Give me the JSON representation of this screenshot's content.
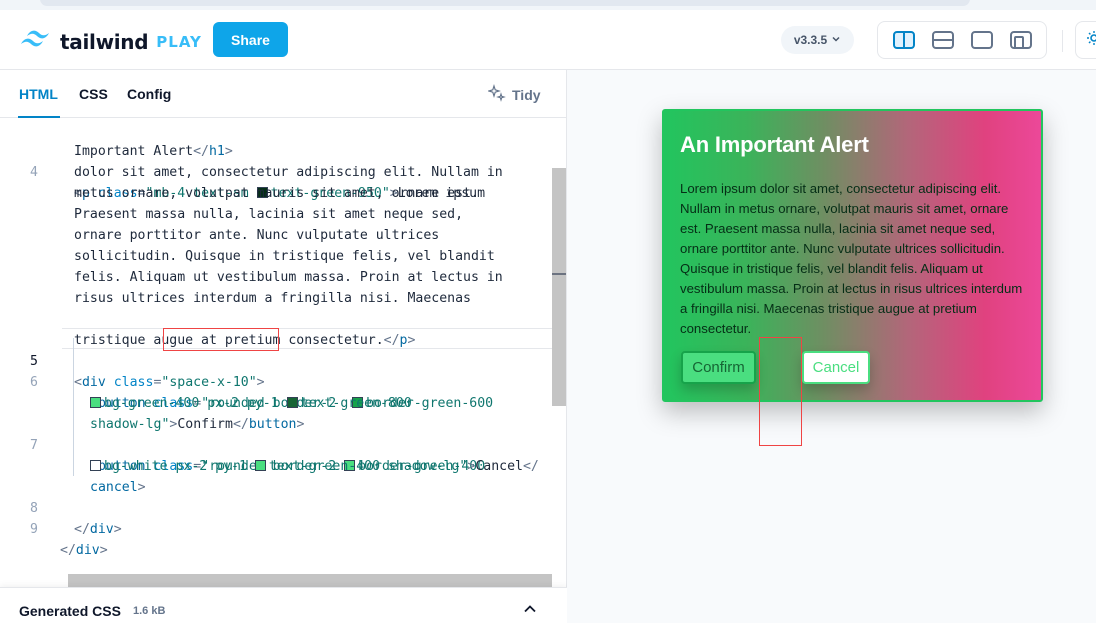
{
  "header": {
    "logo_word": "tailwind",
    "logo_suffix": "PLAY",
    "share_label": "Share",
    "version": "v3.3.5"
  },
  "editor": {
    "tabs": [
      "HTML",
      "CSS",
      "Config"
    ],
    "active_tab": "HTML",
    "tidy_label": "Tidy",
    "lines": {
      "l0": "Important Alert",
      "l4_class": "\"mb-4 text-sm ",
      "l4_class_tail": "text-green-950\"",
      "l4_text1": "Lorem ipsum",
      "l4_wrap1": "dolor sit amet, consectetur adipiscing elit. Nullam in",
      "l4_wrap2": "metus ornare, volutpat mauris sit amet, ornare est.",
      "l4_wrap3": "Praesent massa nulla, lacinia sit amet neque sed,",
      "l4_wrap4": "ornare porttitor ante. Nunc vulputate ultrices",
      "l4_wrap5": "sollicitudin. Quisque in tristique felis, vel blandit",
      "l4_wrap6": "felis. Aliquam ut vestibulum massa. Proin at lectus in",
      "l4_wrap7": "risus ultrices interdum a fringilla nisi. Maecenas",
      "l4_wrap8": "tristique augue at pretium consectetur.",
      "l5_class": "\"space-x-10\"",
      "l6_a": "\"rounded border-2 ",
      "l6_b": "border-green-600",
      "l6_c": "bg-green-400 px-2 py-1 ",
      "l6_d": "text-green-800",
      "l6_e": "shadow-lg\"",
      "l6_text": "Confirm",
      "l7_a": "\"rounded border-2 ",
      "l7_b": "border-green-400",
      "l7_c": "bg-white px-2 py-1 ",
      "l7_d": "text-green-400 shadow-lg\"",
      "l7_text": "Cancel",
      "l7_wrap": "cancel",
      "line_numbers": [
        "4",
        "5",
        "6",
        "7",
        "8",
        "9"
      ]
    },
    "swatch_colors": {
      "green950": "#052e16",
      "green600": "#16a34a",
      "green400": "#4ade80",
      "green800": "#166534",
      "white": "#ffffff"
    }
  },
  "generated_css": {
    "title": "Generated CSS",
    "size": "1.6 kB"
  },
  "preview": {
    "alert_title": "An Important Alert",
    "alert_body": "Lorem ipsum dolor sit amet, consectetur adipiscing elit. Nullam in metus ornare, volutpat mauris sit amet, ornare est. Praesent massa nulla, lacinia sit amet neque sed, ornare porttitor ante. Nunc vulputate ultrices sollicitudin. Quisque in tristique felis, vel blandit felis. Aliquam ut vestibulum massa. Proin at lectus in risus ultrices interdum a fringilla nisi. Maecenas tristique augue at pretium consectetur.",
    "confirm_label": "Confirm",
    "cancel_label": "Cancel"
  },
  "colors": {
    "accent": "#0ea5e9",
    "highlight": "#ef4444"
  }
}
